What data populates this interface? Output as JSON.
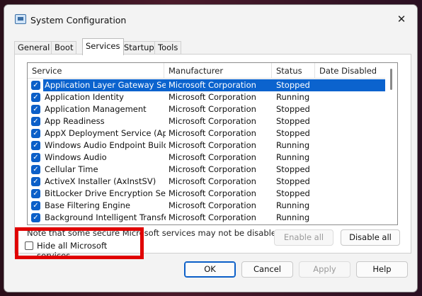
{
  "window": {
    "title": "System Configuration",
    "close_glyph": "✕"
  },
  "tabs": [
    {
      "label": "General"
    },
    {
      "label": "Boot"
    },
    {
      "label": "Services",
      "active": true
    },
    {
      "label": "Startup"
    },
    {
      "label": "Tools"
    }
  ],
  "list": {
    "columns": [
      "Service",
      "Manufacturer",
      "Status",
      "Date Disabled"
    ],
    "rows": [
      {
        "service": "Application Layer Gateway Service",
        "manufacturer": "Microsoft Corporation",
        "status": "Stopped",
        "checked": true,
        "selected": true
      },
      {
        "service": "Application Identity",
        "manufacturer": "Microsoft Corporation",
        "status": "Running",
        "checked": true
      },
      {
        "service": "Application Management",
        "manufacturer": "Microsoft Corporation",
        "status": "Stopped",
        "checked": true
      },
      {
        "service": "App Readiness",
        "manufacturer": "Microsoft Corporation",
        "status": "Stopped",
        "checked": true
      },
      {
        "service": "AppX Deployment Service (AppX...",
        "manufacturer": "Microsoft Corporation",
        "status": "Stopped",
        "checked": true
      },
      {
        "service": "Windows Audio Endpoint Builder",
        "manufacturer": "Microsoft Corporation",
        "status": "Running",
        "checked": true
      },
      {
        "service": "Windows Audio",
        "manufacturer": "Microsoft Corporation",
        "status": "Running",
        "checked": true
      },
      {
        "service": "Cellular Time",
        "manufacturer": "Microsoft Corporation",
        "status": "Stopped",
        "checked": true
      },
      {
        "service": "ActiveX Installer (AxInstSV)",
        "manufacturer": "Microsoft Corporation",
        "status": "Stopped",
        "checked": true
      },
      {
        "service": "BitLocker Drive Encryption Service",
        "manufacturer": "Microsoft Corporation",
        "status": "Stopped",
        "checked": true
      },
      {
        "service": "Base Filtering Engine",
        "manufacturer": "Microsoft Corporation",
        "status": "Running",
        "checked": true
      },
      {
        "service": "Background Intelligent Transfer ...",
        "manufacturer": "Microsoft Corporation",
        "status": "Running",
        "checked": true
      }
    ],
    "check_glyph": "✓"
  },
  "note": "Note that some secure Microsoft services may not be disabled.",
  "buttons": {
    "enable_all": "Enable all",
    "disable_all": "Disable all",
    "ok": "OK",
    "cancel": "Cancel",
    "apply": "Apply",
    "help": "Help"
  },
  "hide_ms": {
    "label": "Hide all Microsoft services",
    "checked": false
  },
  "colors": {
    "selection": "#0b63ce",
    "highlight_box": "#e00000"
  }
}
